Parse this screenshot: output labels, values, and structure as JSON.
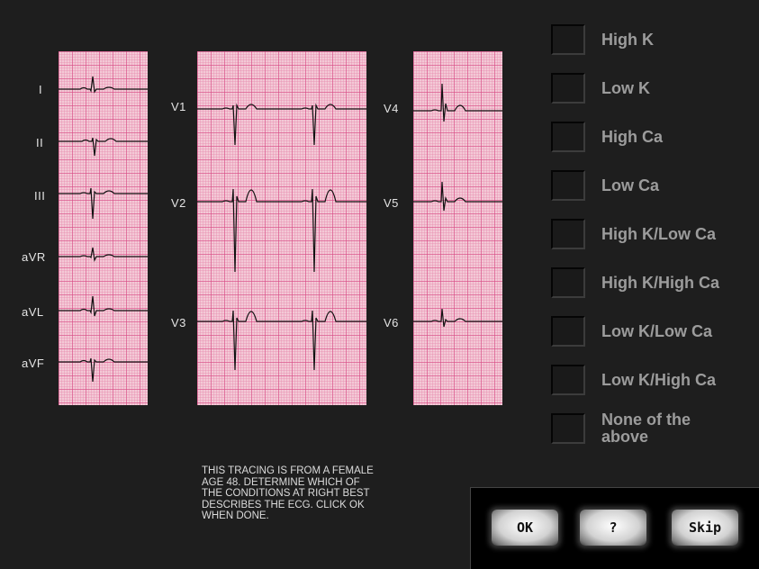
{
  "leads": {
    "col1": [
      "I",
      "II",
      "III",
      "aVR",
      "aVL",
      "aVF"
    ],
    "col2": [
      "V1",
      "V2",
      "V3"
    ],
    "col3": [
      "V4",
      "V5",
      "V6"
    ]
  },
  "options": [
    "High K",
    "Low K",
    "High Ca",
    "Low Ca",
    "High K/Low Ca",
    "High K/High Ca",
    "Low K/Low Ca",
    "Low K/High Ca",
    "None of the above"
  ],
  "instructions": "THIS TRACING IS FROM A FEMALE\nAGE 48.  DETERMINE WHICH OF\nTHE CONDITIONS AT RIGHT BEST\nDESCRIBES THE ECG.  CLICK OK\nWHEN DONE.",
  "buttons": {
    "ok": "OK",
    "help": "?",
    "skip": "Skip"
  },
  "colors": {
    "grid": "#f3c9d6",
    "trace": "#111111",
    "panel": "#1e1e1e"
  }
}
